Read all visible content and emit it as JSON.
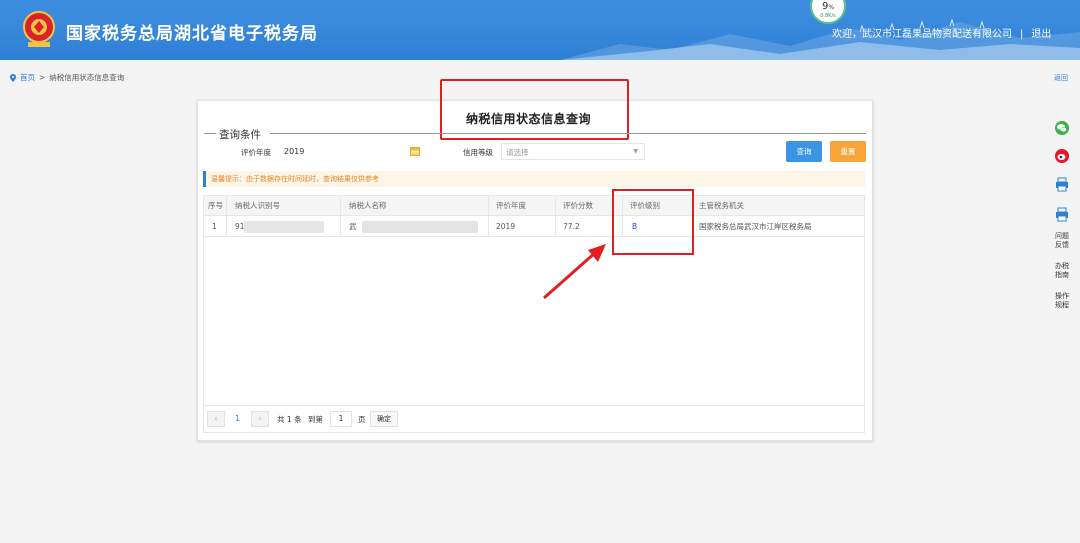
{
  "header": {
    "site_title": "国家税务总局湖北省电子税务局",
    "progress_percent": "9",
    "progress_unit": "%",
    "progress_sub": "0.8K/s",
    "welcome": "欢迎，",
    "company": "武汉市江磊果品物资配送有限公司",
    "separator": "|",
    "logout": "退出"
  },
  "breadcrumb": {
    "home": "首页",
    "arrow": ">",
    "current": "纳税信用状态信息查询"
  },
  "right_link": "返回",
  "side_toolbar": {
    "items": [
      {
        "icon": "wechat-icon",
        "color": "#3bb14a"
      },
      {
        "icon": "weibo-icon",
        "color": "#e6162d"
      },
      {
        "icon": "printer-icon",
        "color": "#2f7fd6"
      },
      {
        "icon": "printer-icon",
        "color": "#2f7fd6"
      }
    ],
    "text_links": [
      "问题反馈",
      "办税指南",
      "操作规程"
    ]
  },
  "page": {
    "title": "纳税信用状态信息查询",
    "legend": "查询条件",
    "year_label": "评价年度",
    "year_value": "2019",
    "credit_label": "信用等级",
    "credit_placeholder": "请选择",
    "query_button": "查询",
    "reset_button": "重置",
    "hint": "温馨提示：由于数据存在时间延时，查询结果仅供参考"
  },
  "table": {
    "columns": [
      "序号",
      "纳税人识别号",
      "纳税人名称",
      "评价年度",
      "评价分数",
      "评价级别",
      "主管税务机关"
    ],
    "rows": [
      {
        "index": "1",
        "tax_id": "914",
        "name": "武",
        "year": "2019",
        "score": "77.2",
        "grade": "B",
        "authority": "国家税务总局武汉市江岸区税务局"
      }
    ]
  },
  "pager": {
    "prev": "‹",
    "current": "1",
    "next": "›",
    "total_prefix": "共",
    "total_count": "1",
    "total_suffix": "条",
    "goto_label": "到第",
    "goto_value": "1",
    "page_unit": "页",
    "confirm": "确定"
  },
  "colors": {
    "header_blue": "#2f7fd6",
    "query_blue": "#3b95e4",
    "reset_orange": "#f7a43b",
    "annotation_red": "#e02020",
    "hint_orange": "#e8842a"
  }
}
